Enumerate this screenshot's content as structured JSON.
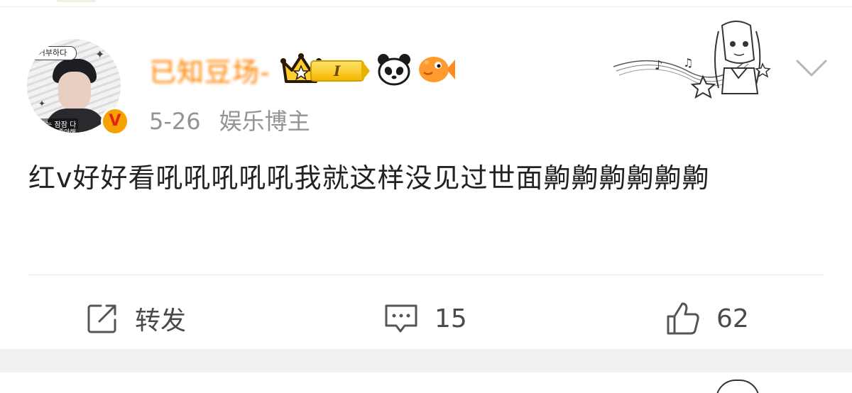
{
  "post": {
    "avatar": {
      "tag_text": "거부하다",
      "caption_line1": "나는 잠잠 다",
      "caption_line2": "좋아해요 좋아해",
      "badge": "V"
    },
    "username": "已知豆场-",
    "level_badge": "I",
    "date": "5-26",
    "user_title": "娱乐博主",
    "content": "红v好好看吼吼吼吼吼我就这样没见过世面齁齁齁齁齁齁",
    "actions": {
      "repost_label": "转发",
      "comment_count": "15",
      "like_count": "62"
    }
  },
  "colors": {
    "username": "#ff8200",
    "meta": "#939393",
    "vip_badge": "#f5a100",
    "separator": "#f1f1f1"
  },
  "icons": [
    "repost-icon",
    "comment-icon",
    "like-icon",
    "chevron-down-icon",
    "crown-icon",
    "panda-icon",
    "fish-icon"
  ]
}
